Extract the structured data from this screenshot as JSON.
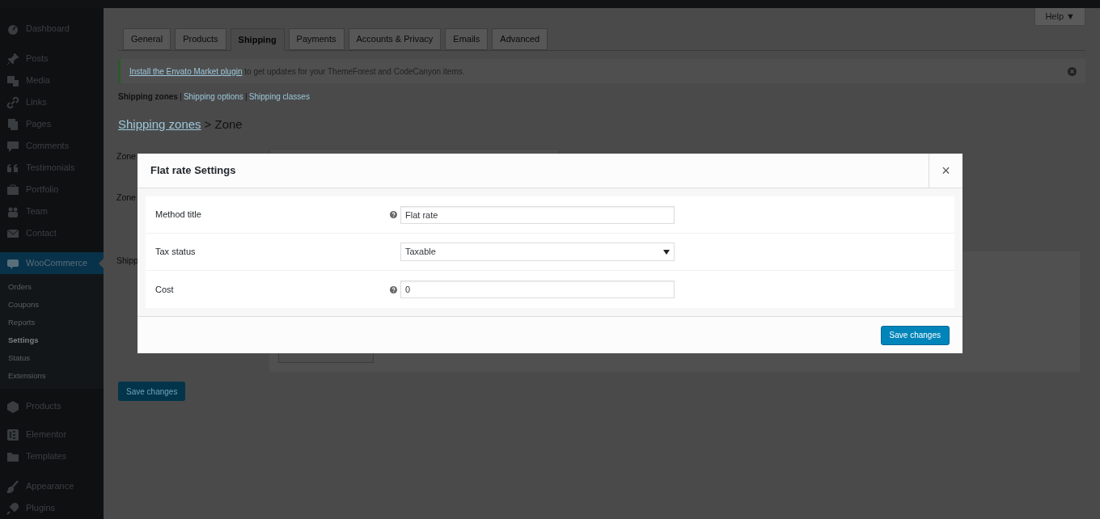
{
  "sidebar": {
    "items": [
      {
        "label": "Dashboard",
        "kind": "gauge",
        "selected": false
      },
      {
        "label": "Posts",
        "kind": "pin",
        "selected": false
      },
      {
        "label": "Media",
        "kind": "media",
        "selected": false
      },
      {
        "label": "Links",
        "kind": "link",
        "selected": false
      },
      {
        "label": "Pages",
        "kind": "pages",
        "selected": false
      },
      {
        "label": "Comments",
        "kind": "bubble",
        "selected": false
      },
      {
        "label": "Testimonials",
        "kind": "quote",
        "selected": false
      },
      {
        "label": "Portfolio",
        "kind": "briefcase",
        "selected": false
      },
      {
        "label": "Team",
        "kind": "people",
        "selected": false
      },
      {
        "label": "Contact",
        "kind": "mail",
        "selected": false
      },
      {
        "label": "WooCommerce",
        "kind": "woo",
        "selected": true,
        "children": [
          {
            "label": "Orders",
            "selected": false
          },
          {
            "label": "Coupons",
            "selected": false
          },
          {
            "label": "Reports",
            "selected": false
          },
          {
            "label": "Settings",
            "selected": true
          },
          {
            "label": "Status",
            "selected": false
          },
          {
            "label": "Extensions",
            "selected": false
          }
        ]
      },
      {
        "label": "Products",
        "kind": "box",
        "selected": false
      },
      {
        "label": "Elementor",
        "kind": "elementor",
        "selected": false
      },
      {
        "label": "Templates",
        "kind": "folder",
        "selected": false
      },
      {
        "label": "Appearance",
        "kind": "brush",
        "selected": false
      },
      {
        "label": "Plugins",
        "kind": "plug",
        "selected": false
      }
    ]
  },
  "help_button": "Help ▼",
  "tabs": [
    {
      "label": "General",
      "selected": false
    },
    {
      "label": "Products",
      "selected": false
    },
    {
      "label": "Shipping",
      "selected": true
    },
    {
      "label": "Payments",
      "selected": false
    },
    {
      "label": "Accounts & Privacy",
      "selected": false
    },
    {
      "label": "Emails",
      "selected": false
    },
    {
      "label": "Advanced",
      "selected": false
    }
  ],
  "notice": {
    "link": "Install the Envato Market plugin",
    "text": " to get updates for your ThemeForest and CodeCanyon items."
  },
  "subnav": [
    {
      "label": "Shipping zones",
      "selected": true
    },
    {
      "label": "Shipping options",
      "selected": false
    },
    {
      "label": "Shipping classes",
      "selected": false
    }
  ],
  "breadcrumb": {
    "link": "Shipping zones",
    "current": "> Zone"
  },
  "form_labels": [
    "Zone",
    "Zone",
    "Shipp"
  ],
  "page_save_button": "Save changes",
  "modal": {
    "title": "Flat rate Settings",
    "close": "×",
    "fields": [
      {
        "label": "Method title",
        "kind": "text",
        "help": true,
        "value": "Flat rate"
      },
      {
        "label": "Tax status",
        "kind": "select",
        "help": false,
        "value": "Taxable"
      },
      {
        "label": "Cost",
        "kind": "text",
        "help": true,
        "value": "0"
      }
    ],
    "save_button": "Save changes"
  }
}
